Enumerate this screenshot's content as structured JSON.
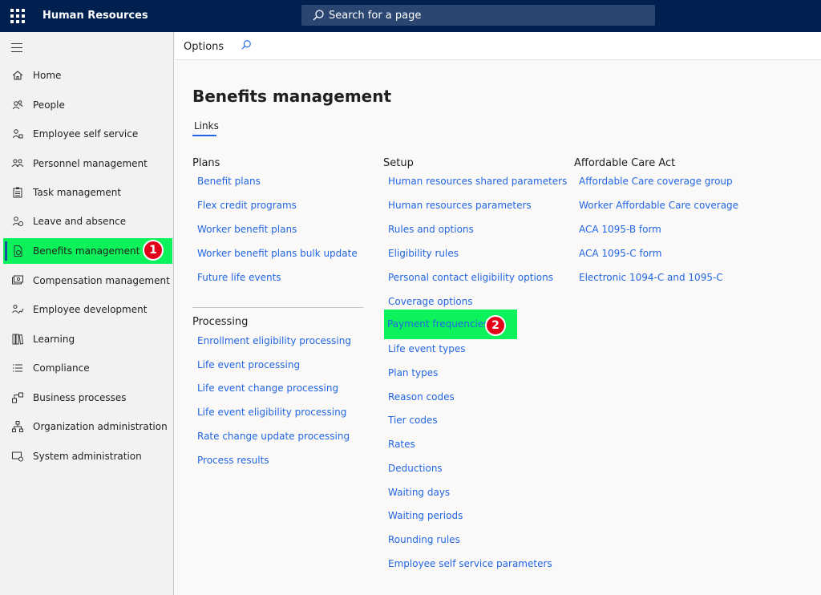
{
  "app": {
    "title": "Human Resources",
    "search_placeholder": "Search for a page"
  },
  "sidebar": {
    "items": [
      {
        "label": "Home",
        "icon": "home-icon"
      },
      {
        "label": "People",
        "icon": "people-icon"
      },
      {
        "label": "Employee self service",
        "icon": "person-icon"
      },
      {
        "label": "Personnel management",
        "icon": "team-icon"
      },
      {
        "label": "Task management",
        "icon": "clipboard-icon"
      },
      {
        "label": "Leave and absence",
        "icon": "person-clock-icon"
      },
      {
        "label": "Benefits management",
        "icon": "document-icon",
        "active": true
      },
      {
        "label": "Compensation management",
        "icon": "money-icon"
      },
      {
        "label": "Employee development",
        "icon": "growth-icon"
      },
      {
        "label": "Learning",
        "icon": "books-icon"
      },
      {
        "label": "Compliance",
        "icon": "list-icon"
      },
      {
        "label": "Business processes",
        "icon": "flow-icon"
      },
      {
        "label": "Organization administration",
        "icon": "org-icon"
      },
      {
        "label": "System administration",
        "icon": "settings-icon"
      }
    ]
  },
  "callouts": {
    "one": "1",
    "two": "2"
  },
  "colors": {
    "highlight": "#0bf25a",
    "callout": "#e3001b",
    "link": "#2266e3",
    "topbar": "#002050"
  },
  "command_bar": {
    "options_label": "Options"
  },
  "main": {
    "title": "Benefits management",
    "tab": "Links",
    "columns": {
      "plans": {
        "heading": "Plans",
        "links": [
          "Benefit plans",
          "Flex credit programs",
          "Worker benefit plans",
          "Worker benefit plans bulk update",
          "Future life events"
        ]
      },
      "processing": {
        "heading": "Processing",
        "links": [
          "Enrollment eligibility processing",
          "Life event processing",
          "Life event change processing",
          "Life event eligibility processing",
          "Rate change update processing",
          "Process results"
        ]
      },
      "setup": {
        "heading": "Setup",
        "links": [
          "Human resources shared parameters",
          "Human resources parameters",
          "Rules and options",
          "Eligibility rules",
          "Personal contact eligibility options",
          "Coverage options",
          "Payment frequencies",
          "Life event types",
          "Plan types",
          "Reason codes",
          "Tier codes",
          "Rates",
          "Deductions",
          "Waiting days",
          "Waiting periods",
          "Rounding rules",
          "Employee self service parameters"
        ]
      },
      "aca": {
        "heading": "Affordable Care Act",
        "links": [
          "Affordable Care coverage group",
          "Worker Affordable Care coverage",
          "ACA 1095-B form",
          "ACA 1095-C form",
          "Electronic 1094-C and 1095-C"
        ]
      }
    }
  }
}
